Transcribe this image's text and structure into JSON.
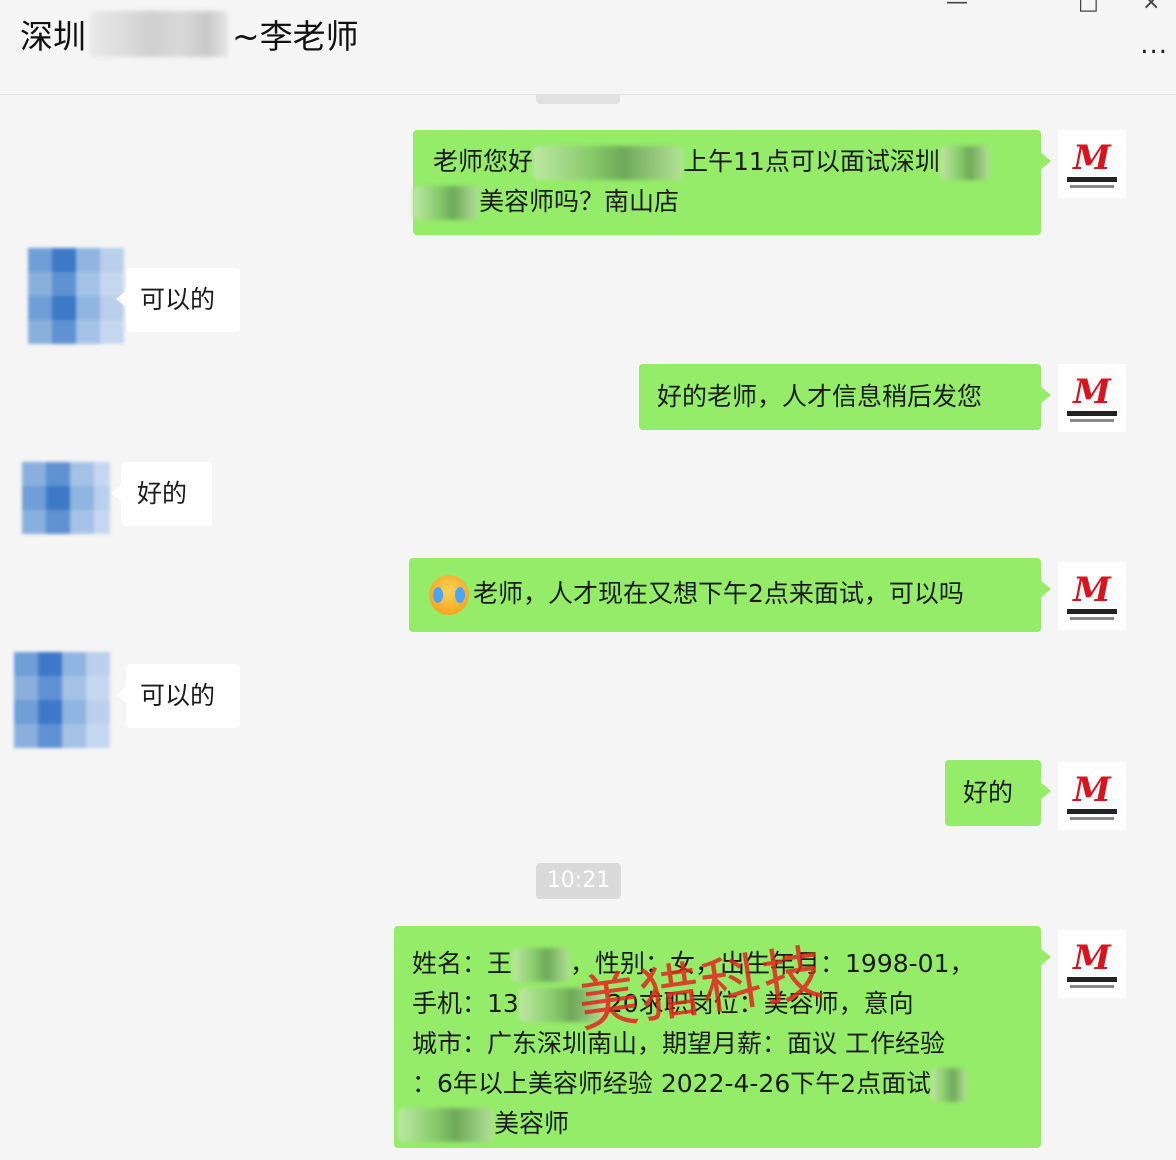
{
  "header": {
    "title_prefix": "深圳",
    "title_suffix": "~李老师",
    "more_label": "...",
    "min_label": "—",
    "max_label": "□",
    "close_label": "×"
  },
  "timestamp": "10:21",
  "watermark": "美猎科技",
  "messages": [
    {
      "side": "right",
      "parts": [
        "老师您好",
        "上午11点可以面试深圳",
        "美容师吗？南山店"
      ]
    },
    {
      "side": "left",
      "text": "可以的"
    },
    {
      "side": "right",
      "text": "好的老师，人才信息稍后发您"
    },
    {
      "side": "left",
      "text": "好的"
    },
    {
      "side": "right",
      "emoji": "crying-face",
      "text": "老师，人才现在又想下午2点来面试，可以吗"
    },
    {
      "side": "left",
      "text": "可以的"
    },
    {
      "side": "right",
      "text": "好的"
    },
    {
      "side": "right",
      "parts": [
        "姓名：王",
        "，性别：女，出生年月：1998-01，",
        "手机：13",
        "20",
        "求职岗位：美容师，意向",
        "城市：广东深圳南山，期望月薪：面议 工作经验",
        "：6年以上美容师经验 2022-4-26下午2点面试",
        "美容师"
      ]
    }
  ],
  "avatar_logo": "M"
}
